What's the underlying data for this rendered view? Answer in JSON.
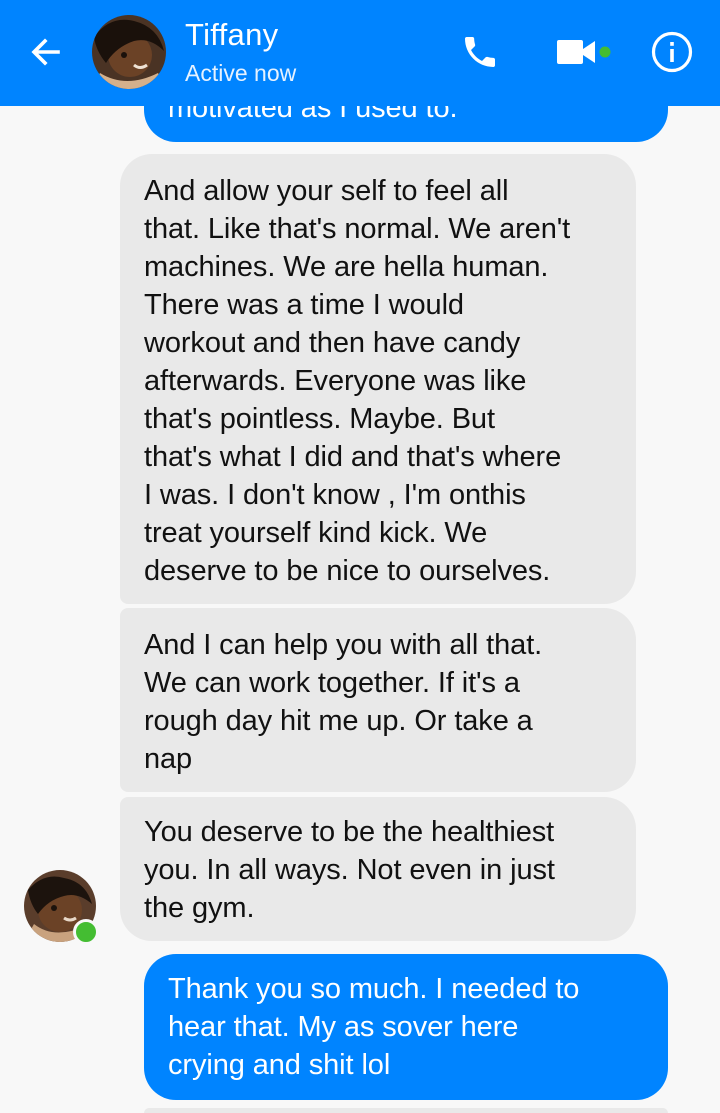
{
  "header": {
    "contact_name": "Tiffany",
    "status": "Active now",
    "icons": {
      "back": "arrow-left-icon",
      "call": "phone-icon",
      "video": "video-camera-icon",
      "info": "info-icon"
    },
    "colors": {
      "bar": "#0084ff",
      "active_dot": "#44bd32"
    }
  },
  "messages": [
    {
      "direction": "sent",
      "text": "motivated as I used to."
    },
    {
      "direction": "received",
      "text": "And allow your self to feel all\nthat. Like that's normal. We aren't\nmachines. We are hella human.\nThere was a time I would\nworkout and then have candy\nafterwards. Everyone was like\nthat's pointless. Maybe. But\nthat's what I did and that's where\nI was. I don't know , I'm onthis\ntreat yourself kind kick. We\ndeserve to be nice to ourselves."
    },
    {
      "direction": "received",
      "text": "And I can help you with all that.\nWe can work together. If it's a\nrough day hit me up. Or take a\nnap"
    },
    {
      "direction": "received",
      "text": "You deserve to be the healthiest\nyou. In all ways. Not even in just\nthe gym."
    },
    {
      "direction": "sent",
      "text": "Thank you so much. I needed to\nhear that. My as sover here\ncrying and shit lol"
    }
  ],
  "colors": {
    "sent_bubble": "#0084ff",
    "received_bubble": "#e9e9e9",
    "background": "#f8f8f8"
  }
}
